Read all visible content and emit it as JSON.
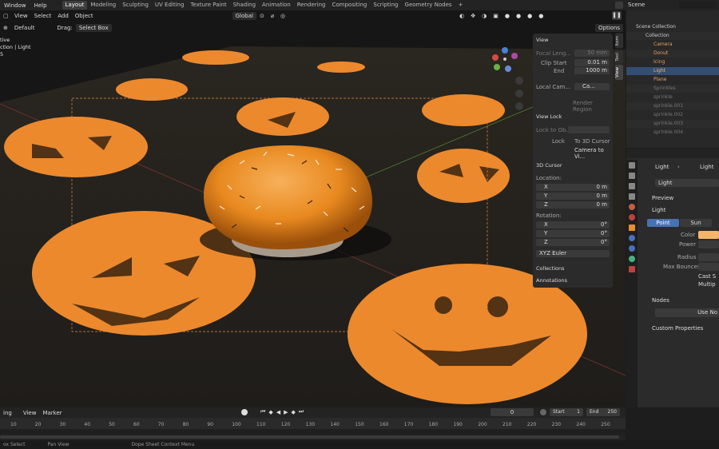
{
  "menu": [
    "Window",
    "Help"
  ],
  "workspaces": [
    "Layout",
    "Modeling",
    "Sculpting",
    "UV Editing",
    "Texture Paint",
    "Shading",
    "Animation",
    "Rendering",
    "Compositing",
    "Scripting",
    "Geometry Nodes"
  ],
  "active_workspace": "Layout",
  "add_tab": "+",
  "scene_name": "Scene",
  "viewport": {
    "menus": [
      "View",
      "Select",
      "Add",
      "Object"
    ],
    "transform_orientation": "Global",
    "options_label": "Options",
    "orientation_label": "Default",
    "drag_label": "Drag:",
    "drag_value": "Select Box",
    "overlay_text": [
      "tive",
      "ction | Light",
      "5"
    ]
  },
  "npanel": {
    "view_header": "View",
    "focal_label": "Focal Leng...",
    "focal_value": "50 mm",
    "clip_start_label": "Clip Start",
    "clip_start_value": "0.01 m",
    "end_label": "End",
    "end_value": "1000 m",
    "local_cam_label": "Local Cam...",
    "local_cam_value": "Ca...",
    "render_region": "Render Region",
    "view_lock_header": "View Lock",
    "lock_to_obj_label": "Lock to Ob...",
    "lock_label": "Lock",
    "to_3d_cursor": "To 3D Cursor",
    "camera_to_view": "Camera to Vi...",
    "cursor_header": "3D Cursor",
    "location_label": "Location:",
    "loc": [
      {
        "axis": "X",
        "value": "0 m"
      },
      {
        "axis": "Y",
        "value": "0 m"
      },
      {
        "axis": "Z",
        "value": "0 m"
      }
    ],
    "rotation_label": "Rotation:",
    "rot": [
      {
        "axis": "X",
        "value": "0°"
      },
      {
        "axis": "Y",
        "value": "0°"
      },
      {
        "axis": "Z",
        "value": "0°"
      }
    ],
    "rotation_mode": "XYZ Euler",
    "collections_header": "Collections",
    "annotations_header": "Annotations",
    "tabs": [
      "Item",
      "Tool",
      "View"
    ]
  },
  "outliner": {
    "root": "Scene Collection",
    "collection": "Collection",
    "items": [
      "Camera",
      "Donut",
      "Icing",
      "Light",
      "Plane"
    ],
    "selected": "Light",
    "sprinkles_collection": "Sprinkles",
    "sprinkles": [
      "sprinkle",
      "sprinkle.001",
      "sprinkle.002",
      "sprinkle.003",
      "sprinkle.004"
    ]
  },
  "properties": {
    "breadcrumb_obj": "Light",
    "breadcrumb_data": "Light",
    "data_name": "Light",
    "preview_header": "Preview",
    "light_header": "Light",
    "types": [
      "Point",
      "Sun"
    ],
    "active_type": "Point",
    "color_label": "Color",
    "power_label": "Power",
    "radius_label": "Radius",
    "max_bounces_label": "Max Bounces",
    "cast_shadow": "Cast S",
    "multiple_imp": "Multip",
    "nodes_header": "Nodes",
    "use_nodes": "Use No",
    "custom_props_header": "Custom Properties",
    "light_color": "#f5b46a"
  },
  "timeline": {
    "menus": [
      "ing",
      "View",
      "Marker"
    ],
    "current_frame": "0",
    "start_label": "Start",
    "start_value": "1",
    "end_label": "End",
    "end_value": "250",
    "ticks": [
      "10",
      "20",
      "30",
      "40",
      "50",
      "60",
      "70",
      "80",
      "90",
      "100",
      "110",
      "120",
      "130",
      "140",
      "150",
      "160",
      "170",
      "180",
      "190",
      "200",
      "210",
      "220",
      "230",
      "240",
      "250"
    ]
  },
  "status": {
    "items": [
      "ox Select",
      "Pan View",
      "Dope Sheet Context Menu"
    ]
  },
  "colors": {
    "accent_orange": "#e98a2c",
    "pumpkin": "#ef8a2e",
    "selection_blue": "#4772b3"
  }
}
